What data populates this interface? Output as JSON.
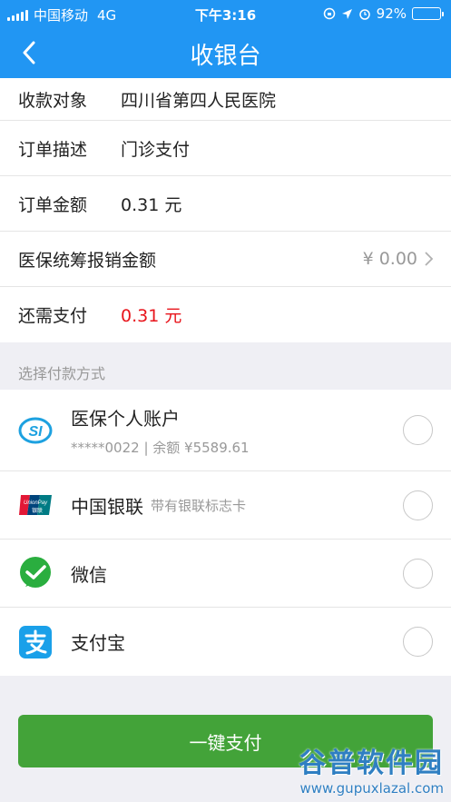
{
  "status_bar": {
    "carrier": "中国移动",
    "network": "4G",
    "time": "下午3:16",
    "battery_percent": "92%",
    "battery_level": 0.92,
    "accent_color": "#2196f3"
  },
  "nav": {
    "back_icon": "chevron-left-icon",
    "title": "收银台"
  },
  "order": {
    "payee_label": "收款对象",
    "payee_value": "四川省第四人民医院",
    "desc_label": "订单描述",
    "desc_value": "门诊支付",
    "amount_label": "订单金额",
    "amount_value": "0.31 元",
    "insurance_label": "医保统筹报销金额",
    "insurance_value": "¥ 0.00",
    "due_label": "还需支付",
    "due_value": "0.31 元",
    "due_color": "#e8141b"
  },
  "payment": {
    "section_title": "选择付款方式",
    "methods": [
      {
        "name": "医保个人账户",
        "sub": "*****0022 | 余额 ¥5589.61",
        "icon": "social-insurance-icon"
      },
      {
        "name": "中国银联",
        "sub": "带有银联标志卡",
        "icon": "unionpay-icon"
      },
      {
        "name": "微信",
        "sub": "",
        "icon": "wechat-icon"
      },
      {
        "name": "支付宝",
        "sub": "",
        "icon": "alipay-icon"
      }
    ]
  },
  "pay_button": {
    "label": "一键支付",
    "color": "#43a339"
  },
  "watermark": {
    "main": "谷普软件园",
    "url": "www.gupuxlazal.com"
  }
}
